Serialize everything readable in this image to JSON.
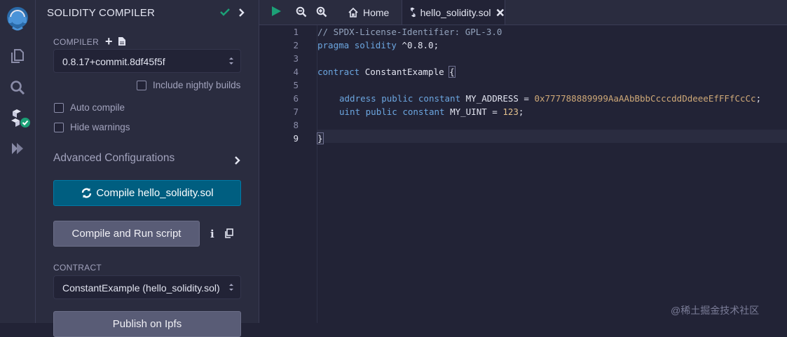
{
  "rail": {
    "icons": [
      "remix-logo-icon",
      "file-explorer-icon",
      "search-icon",
      "solidity-compiler-icon",
      "deploy-run-icon"
    ]
  },
  "panel": {
    "title": "SOLIDITY COMPILER",
    "compiler_label": "COMPILER",
    "compiler_version": "0.8.17+commit.8df45f5f",
    "include_nightly_label": "Include nightly builds",
    "include_nightly_checked": false,
    "auto_compile_label": "Auto compile",
    "auto_compile_checked": false,
    "hide_warnings_label": "Hide warnings",
    "hide_warnings_checked": false,
    "advanced_label": "Advanced Configurations",
    "compile_button_label": "Compile hello_solidity.sol",
    "compile_run_label": "Compile and Run script",
    "contract_label": "CONTRACT",
    "contract_selected": "ConstantExample (hello_solidity.sol)",
    "publish_label": "Publish on Ipfs"
  },
  "topbar": {
    "home_tab_label": "Home",
    "file_tab_label": "hello_solidity.sol"
  },
  "editor": {
    "line_numbers": [
      "1",
      "2",
      "3",
      "4",
      "5",
      "6",
      "7",
      "8",
      "9"
    ],
    "current_line": "9",
    "lines": {
      "l1": "// SPDX-License-Identifier: GPL-3.0",
      "l2_kw1": "pragma",
      "l2_kw2": "solidity",
      "l2_rest": " ^0.8.0;",
      "l4_kw": "contract",
      "l4_name": " ConstantExample ",
      "l4_brace": "{",
      "l6_kw1": "address",
      "l6_kw2": "public",
      "l6_kw3": "constant",
      "l6_name": " MY_ADDRESS = ",
      "l6_addr": "0x777788889999AaAAbBbbCcccddDdeeeEfFFfCcCc",
      "l6_end": ";",
      "l7_kw1": "uint",
      "l7_kw2": "public",
      "l7_kw3": "constant",
      "l7_name": " MY_UINT = ",
      "l7_num": "123",
      "l7_end": ";",
      "l9_brace": "}"
    }
  },
  "watermark": "@稀土掘金技术社区",
  "colors": {
    "accent": "#005e80",
    "success": "#1ca077",
    "background": "#222336",
    "panel": "#2a2c3f"
  }
}
